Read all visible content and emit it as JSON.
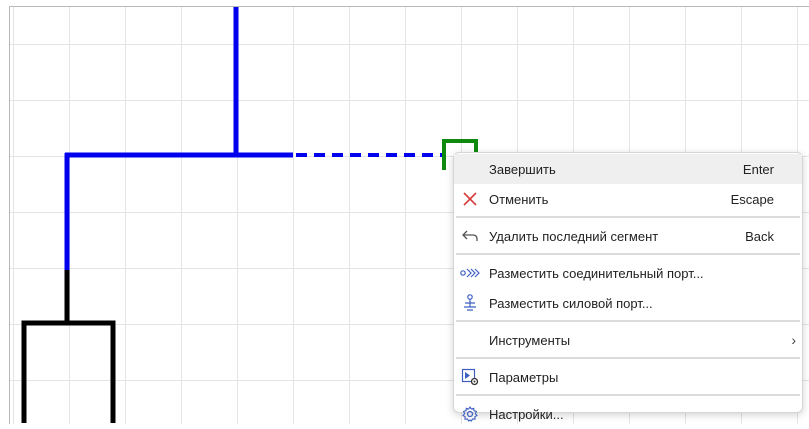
{
  "menu": {
    "items": [
      {
        "label": "Завершить",
        "shortcut": "Enter",
        "icon": "none"
      },
      {
        "label": "Отменить",
        "shortcut": "Escape",
        "icon": "close-icon"
      },
      {
        "label": "Удалить последний сегмент",
        "shortcut": "Back",
        "icon": "undo-arrow-icon"
      },
      {
        "label": "Разместить соединительный порт...",
        "shortcut": "",
        "icon": "connection-port-icon"
      },
      {
        "label": "Разместить силовой порт...",
        "shortcut": "",
        "icon": "power-port-icon"
      },
      {
        "label": "Инструменты",
        "shortcut": "",
        "icon": "none",
        "submenu_indicator": "›"
      },
      {
        "label": "Параметры",
        "shortcut": "",
        "icon": "parameters-icon"
      },
      {
        "label": "Настройки...",
        "shortcut": "",
        "icon": "gear-icon"
      }
    ]
  },
  "colors": {
    "wire_active": "#0000ee",
    "wire_inactive": "#000000",
    "port_marker": "#0f8a0f",
    "cancel_icon": "#d83b3b",
    "icon_blue": "#3d5fc4",
    "menu_highlight": "#efefef"
  }
}
